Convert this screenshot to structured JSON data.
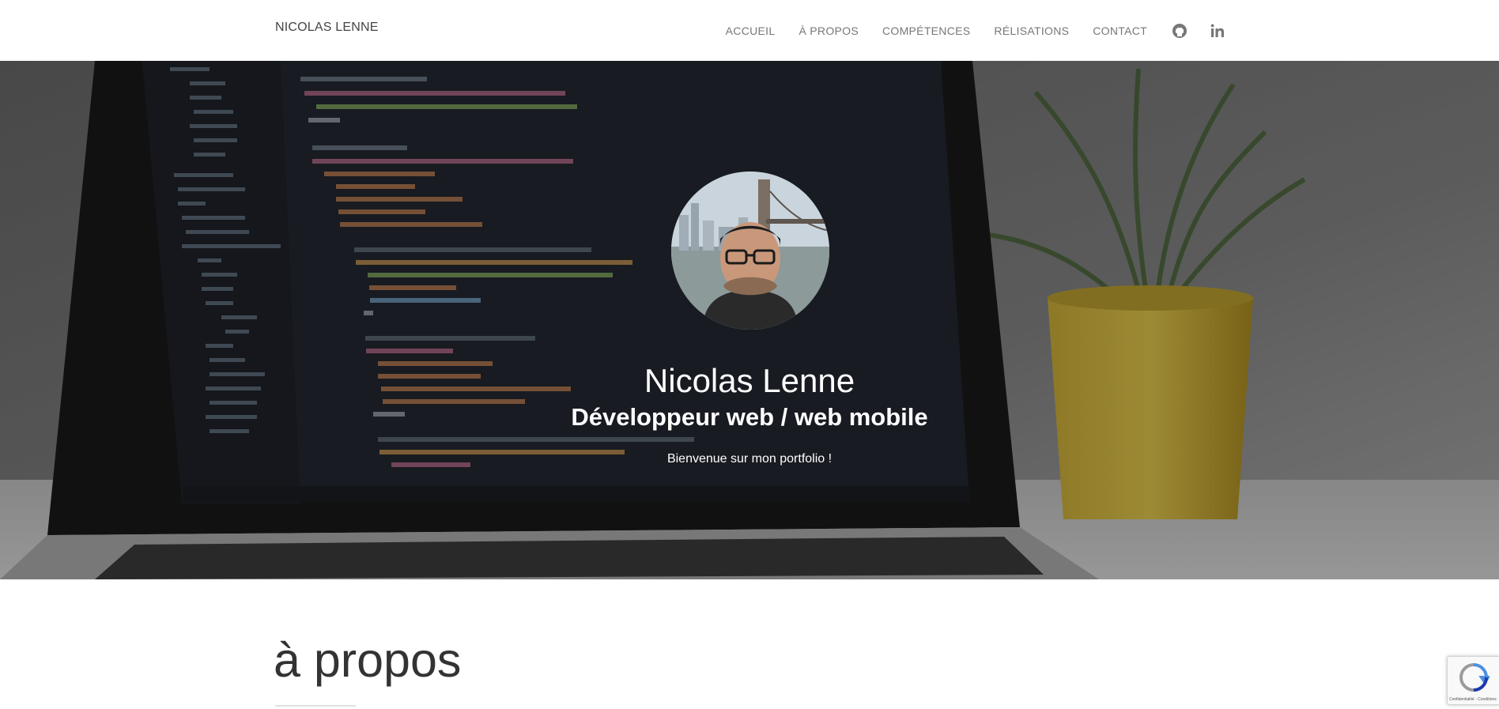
{
  "nav": {
    "brand": "NICOLAS LENNE",
    "items": [
      {
        "label": "ACCUEIL"
      },
      {
        "label": "À PROPOS"
      },
      {
        "label": "COMPÉTENCES"
      },
      {
        "label": "RÉLISATIONS"
      },
      {
        "label": "CONTACT"
      }
    ],
    "icons": [
      "github-icon",
      "linkedin-icon"
    ]
  },
  "hero": {
    "name": "Nicolas Lenne",
    "title": "Développeur web / web mobile",
    "welcome": "Bienvenue sur mon portfolio !"
  },
  "about": {
    "title": "à propos"
  },
  "recaptcha": {
    "footer": "Confidentialité - Conditions"
  },
  "colors": {
    "nav_text": "#777777",
    "brand_text": "#444444",
    "hero_text": "#ffffff",
    "heading": "#333333"
  }
}
